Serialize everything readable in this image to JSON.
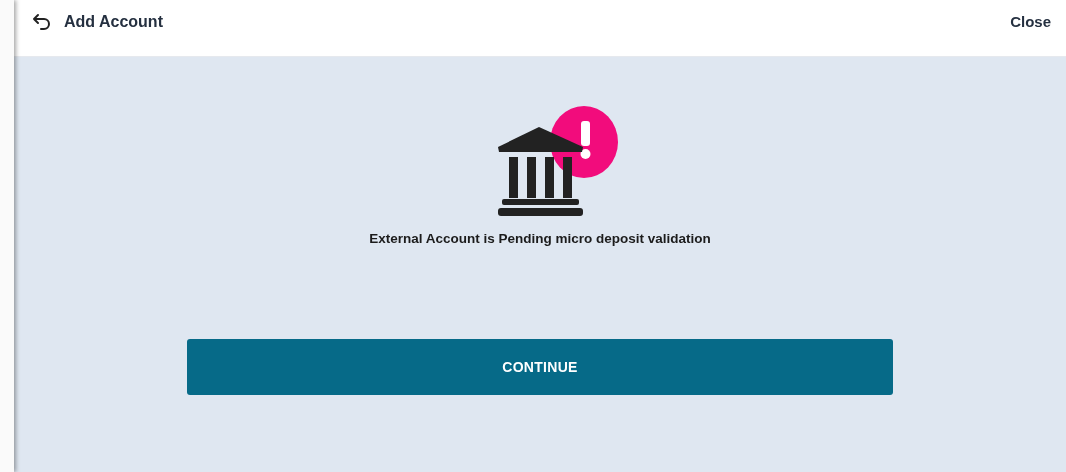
{
  "header": {
    "title": "Add Account",
    "close": "Close"
  },
  "message": "External Account is Pending micro deposit validation",
  "button": "CONTINUE"
}
